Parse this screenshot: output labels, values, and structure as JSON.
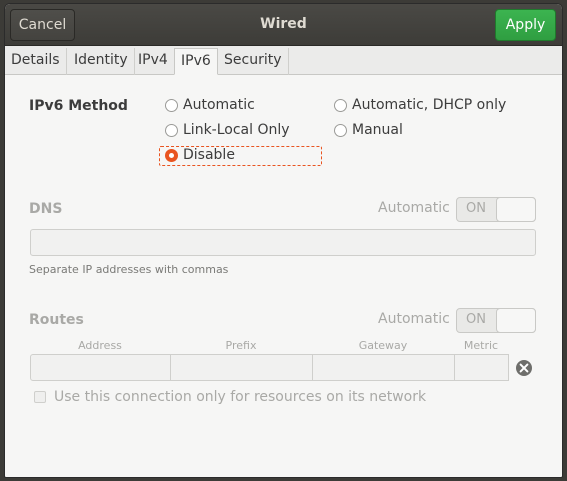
{
  "header": {
    "title": "Wired",
    "cancel_label": "Cancel",
    "apply_label": "Apply"
  },
  "tabs": [
    {
      "label": "Details"
    },
    {
      "label": "Identity"
    },
    {
      "label": "IPv4"
    },
    {
      "label": "IPv6",
      "active": true
    },
    {
      "label": "Security"
    }
  ],
  "ipv6_method": {
    "label": "IPv6 Method",
    "options": [
      {
        "label": "Automatic",
        "selected": false
      },
      {
        "label": "Automatic, DHCP only",
        "selected": false
      },
      {
        "label": "Link-Local Only",
        "selected": false
      },
      {
        "label": "Manual",
        "selected": false
      },
      {
        "label": "Disable",
        "selected": true
      }
    ]
  },
  "dns": {
    "label": "DNS",
    "automatic_label": "Automatic",
    "switch_state": "ON",
    "value": "",
    "hint": "Separate IP addresses with commas"
  },
  "routes": {
    "label": "Routes",
    "automatic_label": "Automatic",
    "switch_state": "ON",
    "columns": [
      "Address",
      "Prefix",
      "Gateway",
      "Metric"
    ],
    "rows": [
      {
        "address": "",
        "prefix": "",
        "gateway": "",
        "metric": ""
      }
    ],
    "only_resources_label": "Use this connection only for resources on its network",
    "only_resources_checked": false
  },
  "colors": {
    "accent": "#e95420",
    "apply": "#34a849",
    "headerbar": "#3f3e3a"
  }
}
